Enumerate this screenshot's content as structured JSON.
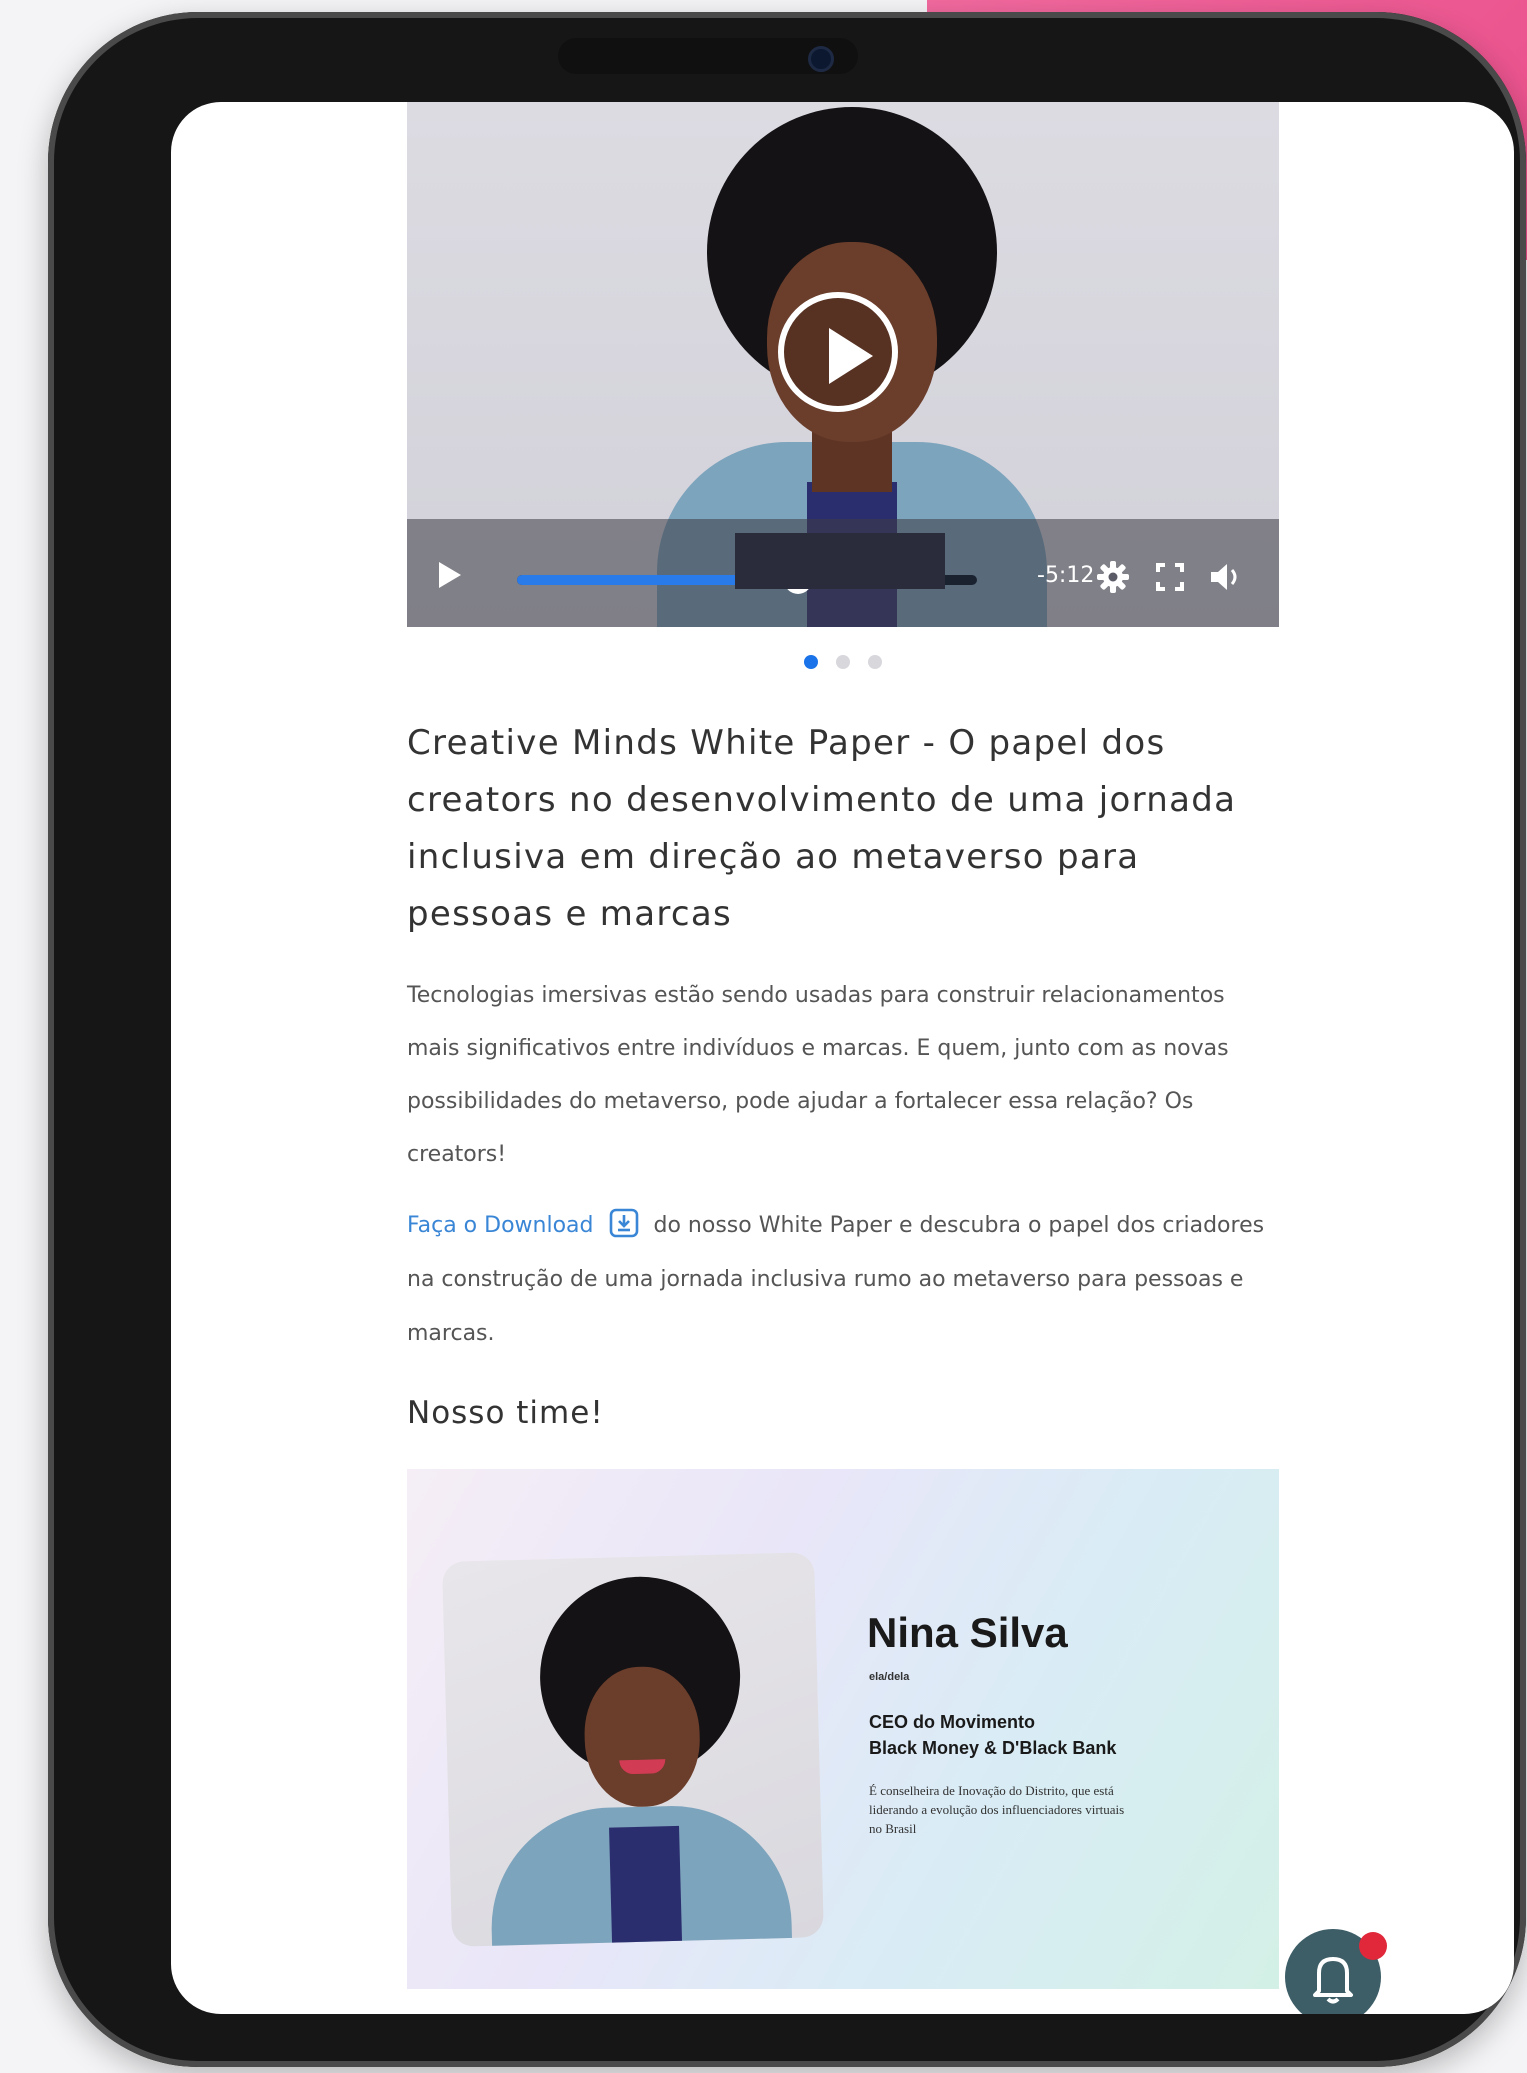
{
  "video": {
    "tooltip_text": "",
    "time_remaining": "-5:12",
    "progress_percent": 61,
    "slides_total": 3,
    "active_slide": 1
  },
  "article": {
    "title": "Creative Minds White Paper - O papel dos creators no desenvolvimento de uma jornada inclusiva em direção ao metaverso para pessoas e marcas",
    "intro": "Tecnologias imersivas estão sendo usadas para construir relacionamentos mais significativos entre indivíduos e marcas. E quem, junto com as novas possibilidades do metaverso, pode ajudar a fortalecer essa relação? Os creators!",
    "download_link": "Faça o Download",
    "download_rest": "do nosso White Paper e descubra o papel dos criadores na construção de uma jornada inclusiva rumo ao metaverso para pessoas e marcas."
  },
  "team": {
    "heading": "Nosso time!",
    "member": {
      "name": "Nina Silva",
      "pronoun": "ela/dela",
      "role_line1": "CEO do Movimento",
      "role_line2": "Black Money & D'Black Bank",
      "description": "É conselheira de Inovação do Distrito, que está liderando a evolução dos influenciadores virtuais no Brasil"
    }
  },
  "colors": {
    "accent": "#1a73e8",
    "link": "#3a86d6",
    "brand_pink": "#e94e8a",
    "notification": "#e0283a"
  },
  "icons": {
    "play": "play-icon",
    "settings": "gear-icon",
    "fullscreen": "fullscreen-icon",
    "volume": "volume-icon",
    "download": "download-icon",
    "notification": "bell-icon"
  }
}
